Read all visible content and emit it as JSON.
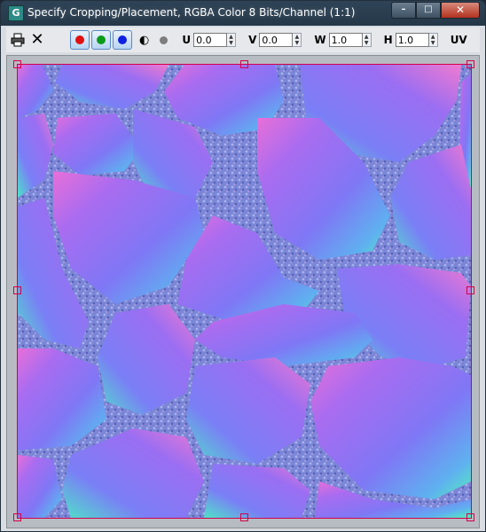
{
  "window": {
    "title": "Specify Cropping/Placement, RGBA Color 8 Bits/Channel (1:1)",
    "app_icon_letter": "G",
    "minimize_glyph": "–",
    "maximize_glyph": "□",
    "close_glyph": "✕"
  },
  "toolbar": {
    "print_icon": "printer-icon",
    "close_icon": "close-icon",
    "close_glyph": "✕",
    "channels": [
      {
        "name": "red-channel",
        "color": "#e01010"
      },
      {
        "name": "green-channel",
        "color": "#0a9b1a"
      },
      {
        "name": "blue-channel",
        "color": "#1020e0"
      }
    ],
    "mono_glyph": "◐",
    "u": {
      "label": "U",
      "value": "0.0"
    },
    "v": {
      "label": "V",
      "value": "0.0"
    },
    "w": {
      "label": "W",
      "value": "1.0"
    },
    "h": {
      "label": "H",
      "value": "1.0"
    },
    "uv_label": "UV",
    "spin_up": "▲",
    "spin_down": "▼"
  },
  "viewport": {
    "image": "normal-map-stones",
    "crop_border_color": "#d4004a"
  }
}
